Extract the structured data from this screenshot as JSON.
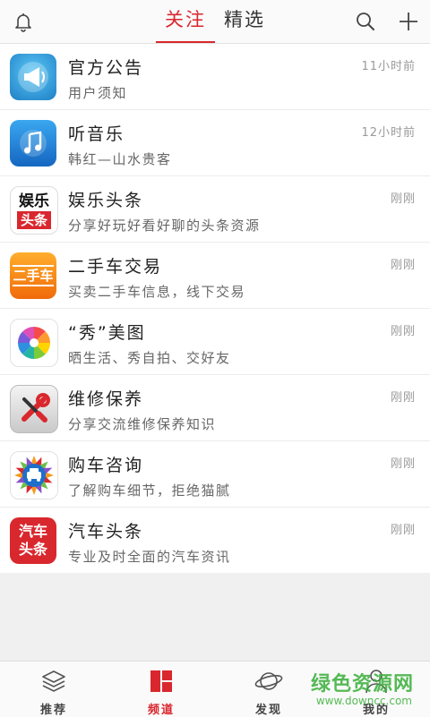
{
  "header": {
    "tabs": [
      {
        "label": "关注",
        "active": true
      },
      {
        "label": "精选",
        "active": false
      }
    ],
    "left_icon": "bell-icon",
    "right_icons": [
      "search-icon",
      "plus-icon"
    ],
    "accent_color": "#d9272e"
  },
  "channels": [
    {
      "title": "官方公告",
      "subtitle": "用户须知",
      "time": "11小时前",
      "icon": "megaphone-icon"
    },
    {
      "title": "听音乐",
      "subtitle": "韩红—山水贵客",
      "time": "12小时前",
      "icon": "music-note-icon"
    },
    {
      "title": "娱乐头条",
      "subtitle": "分享好玩好看好聊的头条资源",
      "time": "刚刚",
      "icon": "entertainment-headline-icon",
      "icon_text": [
        "娱乐",
        "头条"
      ]
    },
    {
      "title": "二手车交易",
      "subtitle": "买卖二手车信息，线下交易",
      "time": "刚刚",
      "icon": "used-car-icon",
      "icon_text": [
        "二手车"
      ]
    },
    {
      "title": "“秀”美图",
      "subtitle": "晒生活、秀自拍、交好友",
      "time": "刚刚",
      "icon": "pinwheel-photo-icon"
    },
    {
      "title": "维修保养",
      "subtitle": "分享交流维修保养知识",
      "time": "刚刚",
      "icon": "wrench-screwdriver-icon"
    },
    {
      "title": "购车咨询",
      "subtitle": "了解购车细节，拒绝猫腻",
      "time": "刚刚",
      "icon": "car-badge-icon"
    },
    {
      "title": "汽车头条",
      "subtitle": "专业及时全面的汽车资讯",
      "time": "刚刚",
      "icon": "car-headline-icon",
      "icon_text": [
        "汽车",
        "头条"
      ]
    }
  ],
  "bottom_nav": [
    {
      "label": "推荐",
      "icon": "layers-icon",
      "active": false
    },
    {
      "label": "频道",
      "icon": "channel-grid-icon",
      "active": true
    },
    {
      "label": "发现",
      "icon": "planet-icon",
      "active": false
    },
    {
      "label": "我的",
      "icon": "person-icon",
      "active": false
    }
  ],
  "watermark": {
    "text": "绿色资源网",
    "url": "www.downcc.com"
  }
}
